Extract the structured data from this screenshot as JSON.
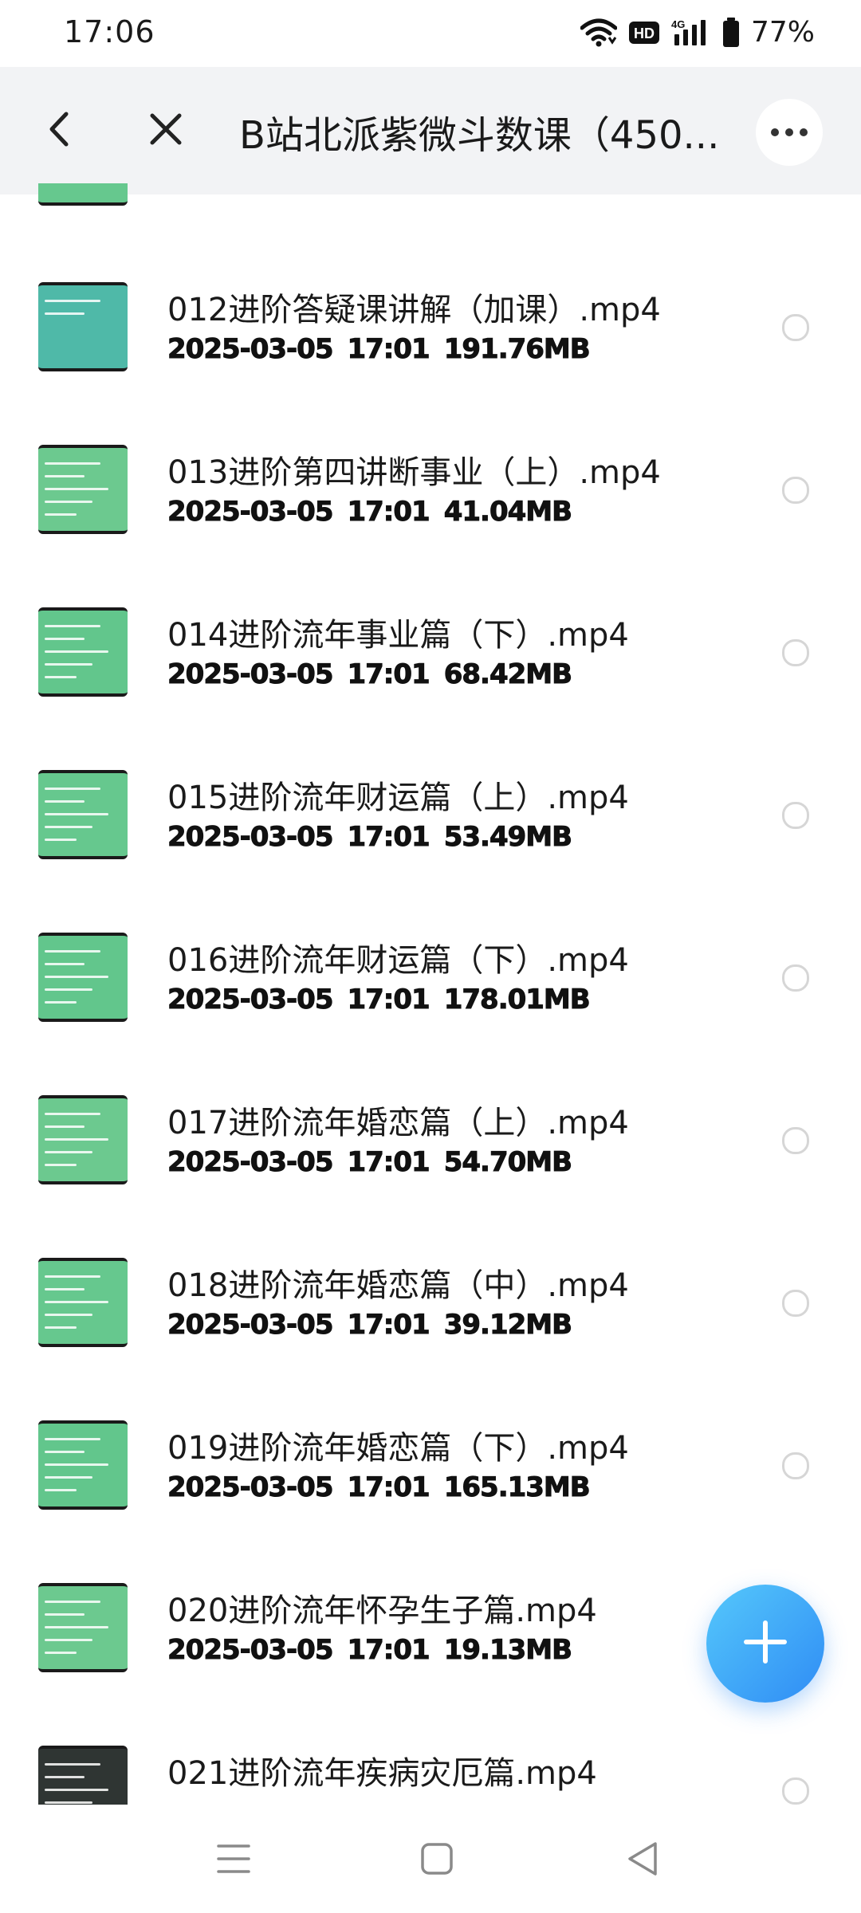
{
  "status_bar": {
    "time": "17:06",
    "network": "4G",
    "hd_label": "HD",
    "battery": "77%"
  },
  "header": {
    "title": "B站北派紫微斗数课（450...",
    "back_icon": "back-arrow-icon",
    "close_icon": "close-icon",
    "more_icon": "more-icon"
  },
  "files": [
    {
      "name": "012进阶答疑课讲解（加课）.mp4",
      "date": "2025-03-05",
      "time": "17:01",
      "size": "191.76MB",
      "thumb_color": "#4fb9a8"
    },
    {
      "name": "013进阶第四讲断事业（上）.mp4",
      "date": "2025-03-05",
      "time": "17:01",
      "size": "41.04MB",
      "thumb_color": "#6cc98f"
    },
    {
      "name": "014进阶流年事业篇（下）.mp4",
      "date": "2025-03-05",
      "time": "17:01",
      "size": "68.42MB",
      "thumb_color": "#62c68c"
    },
    {
      "name": "015进阶流年财运篇（上）.mp4",
      "date": "2025-03-05",
      "time": "17:01",
      "size": "53.49MB",
      "thumb_color": "#66c88e"
    },
    {
      "name": "016进阶流年财运篇（下）.mp4",
      "date": "2025-03-05",
      "time": "17:01",
      "size": "178.01MB",
      "thumb_color": "#62c68c"
    },
    {
      "name": "017进阶流年婚恋篇（上）.mp4",
      "date": "2025-03-05",
      "time": "17:01",
      "size": "54.70MB",
      "thumb_color": "#6cc98f"
    },
    {
      "name": "018进阶流年婚恋篇（中）.mp4",
      "date": "2025-03-05",
      "time": "17:01",
      "size": "39.12MB",
      "thumb_color": "#66c88e"
    },
    {
      "name": "019进阶流年婚恋篇（下）.mp4",
      "date": "2025-03-05",
      "time": "17:01",
      "size": "165.13MB",
      "thumb_color": "#62c68c"
    },
    {
      "name": "020进阶流年怀孕生子篇.mp4",
      "date": "2025-03-05",
      "time": "17:01",
      "size": "19.13MB",
      "thumb_color": "#6cc98f"
    },
    {
      "name": "021进阶流年疾病灾厄篇.mp4",
      "date": "",
      "time": "",
      "size": "",
      "thumb_color": "#2f3533"
    }
  ],
  "fab": {
    "icon": "plus-icon"
  },
  "nav": {
    "menu_icon": "menu-icon",
    "home_icon": "home-icon",
    "back_icon": "nav-back-icon"
  }
}
